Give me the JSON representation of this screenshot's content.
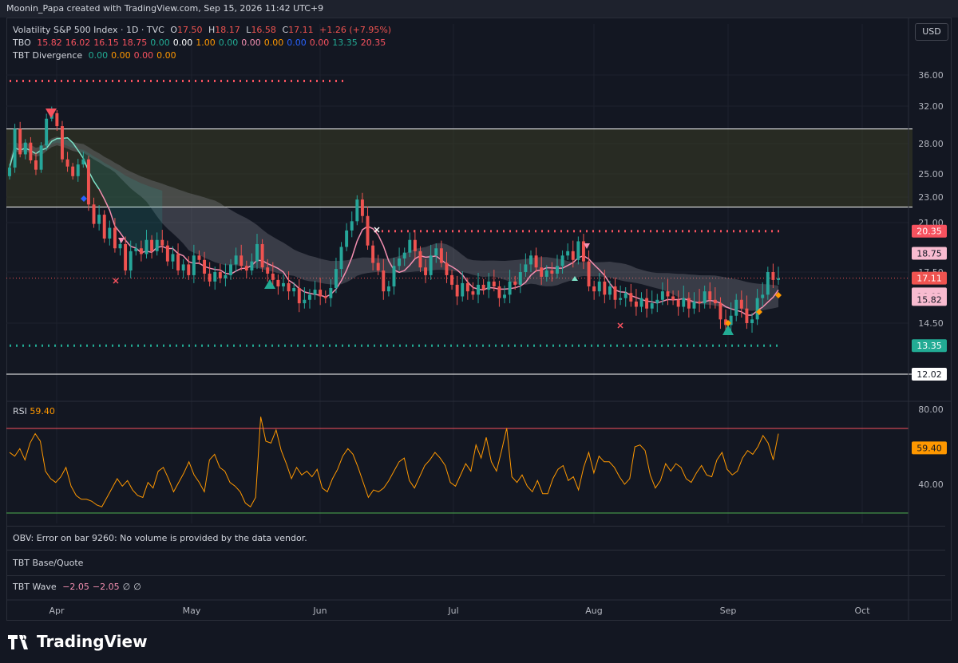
{
  "header": {
    "credit": "Moonin_Papa created with TradingView.com, Sep 15, 2026 11:42 UTC+9"
  },
  "legend": {
    "symbol": "Volatility S&P 500 Index · 1D · TVC",
    "ohlc": {
      "o_label": "O",
      "o": "17.50",
      "h_label": "H",
      "h": "18.17",
      "l_label": "L",
      "l": "16.58",
      "c_label": "C",
      "c": "17.11",
      "change": "+1.26 (+7.95%)"
    },
    "tbo_label": "TBO",
    "tbo_values": [
      {
        "v": "15.82",
        "color": "#f7525f"
      },
      {
        "v": "16.02",
        "color": "#f7525f"
      },
      {
        "v": "16.15",
        "color": "#f7525f"
      },
      {
        "v": "18.75",
        "color": "#f7525f"
      },
      {
        "v": "0.00",
        "color": "#22ab94"
      },
      {
        "v": "0.00",
        "color": "#ffffff"
      },
      {
        "v": "1.00",
        "color": "#ff9800"
      },
      {
        "v": "0.00",
        "color": "#22ab94"
      },
      {
        "v": "0.00",
        "color": "#f48fb1"
      },
      {
        "v": "0.00",
        "color": "#ff9800"
      },
      {
        "v": "0.00",
        "color": "#2962ff"
      },
      {
        "v": "0.00",
        "color": "#f7525f"
      },
      {
        "v": "13.35",
        "color": "#22ab94"
      },
      {
        "v": "20.35",
        "color": "#f7525f"
      }
    ],
    "div_label": "TBT Divergence",
    "div_values": [
      {
        "v": "0.00",
        "color": "#22ab94"
      },
      {
        "v": "0.00",
        "color": "#ff9800"
      },
      {
        "v": "0.00",
        "color": "#f7525f"
      },
      {
        "v": "0.00",
        "color": "#ff9800"
      }
    ]
  },
  "currency_button": "USD",
  "colors": {
    "up": "#26a69a",
    "down": "#ef5350",
    "bg": "#131722",
    "grid": "#1e222d",
    "rsi": "#ff9800",
    "pink": "#f48fb1"
  },
  "chart_data": {
    "type": "candlestick",
    "x_labels": [
      "Apr",
      "May",
      "Jun",
      "Jul",
      "Aug",
      "Sep",
      "Oct"
    ],
    "price_ticks": [
      "36.00",
      "32.00",
      "28.00",
      "25.00",
      "23.00",
      "21.00",
      "17.50",
      "14.50"
    ],
    "price_tags": [
      {
        "label": "20.35",
        "value": 20.35,
        "bg": "#f7525f",
        "fg": "#ffffff"
      },
      {
        "label": "18.75",
        "value": 18.75,
        "bg": "#f8bbd0",
        "fg": "#131722"
      },
      {
        "label": "17.11",
        "value": 17.11,
        "bg": "#ef5350",
        "fg": "#ffffff"
      },
      {
        "label": "16.15",
        "value": 16.15,
        "bg": "#f8bbd0",
        "fg": "#131722"
      },
      {
        "label": "16.02",
        "value": 16.02,
        "bg": "#f8bbd0",
        "fg": "#131722"
      },
      {
        "label": "15.82",
        "value": 15.82,
        "bg": "#f8bbd0",
        "fg": "#131722"
      },
      {
        "label": "13.35",
        "value": 13.35,
        "bg": "#22ab94",
        "fg": "#ffffff"
      },
      {
        "label": "12.02",
        "value": 12.02,
        "bg": "#ffffff",
        "fg": "#131722"
      }
    ],
    "levels": {
      "upper_box": 29.5,
      "mid_line": 22.2,
      "lower_line": 12.02,
      "red_dot_high": 35.2,
      "red_dot_mid": 20.35,
      "green_dot": 13.35
    },
    "closes": [
      25.6,
      29.5,
      26.9,
      28.1,
      26.3,
      25.4,
      27.8,
      30.6,
      31.2,
      29.8,
      26.4,
      25.7,
      24.8,
      25.9,
      26.4,
      22.4,
      20.9,
      21.6,
      19.8,
      20.6,
      19.1,
      19.4,
      17.6,
      18.9,
      19.1,
      18.7,
      19.7,
      18.9,
      19.7,
      19.3,
      18.2,
      18.7,
      17.6,
      18.0,
      17.3,
      18.6,
      18.3,
      17.4,
      16.9,
      17.5,
      17.1,
      17.3,
      18.0,
      18.6,
      17.9,
      17.6,
      18.2,
      19.4,
      17.8,
      17.4,
      17.0,
      16.6,
      16.8,
      16.3,
      16.5,
      15.6,
      15.8,
      16.1,
      16.4,
      16.0,
      15.9,
      16.5,
      17.7,
      19.2,
      20.4,
      21.1,
      22.8,
      21.5,
      19.3,
      18.1,
      17.6,
      16.3,
      16.6,
      17.9,
      18.4,
      18.8,
      19.7,
      18.9,
      17.8,
      17.3,
      18.6,
      19.1,
      18.1,
      17.3,
      16.7,
      16.0,
      16.8,
      16.3,
      16.1,
      16.7,
      16.4,
      16.9,
      16.6,
      15.9,
      16.1,
      16.9,
      16.7,
      17.5,
      18.0,
      18.6,
      17.8,
      17.2,
      17.6,
      17.4,
      17.9,
      18.6,
      18.9,
      18.3,
      19.6,
      18.2,
      16.6,
      16.3,
      16.9,
      16.1,
      16.6,
      15.8,
      15.9,
      16.2,
      15.7,
      15.4,
      15.9,
      15.3,
      15.6,
      15.8,
      16.3,
      16.0,
      15.8,
      15.4,
      15.9,
      15.3,
      15.7,
      15.6,
      16.3,
      15.8,
      15.6,
      14.7,
      14.4,
      14.9,
      15.8,
      15.3,
      14.5,
      14.7,
      15.9,
      16.1,
      17.5,
      17.0,
      17.1
    ],
    "rsi_label": "RSI",
    "rsi_value_label": "59.40",
    "rsi_ticks": [
      "80.00",
      "40.00"
    ],
    "rsi": [
      57,
      55,
      59,
      53,
      62,
      67,
      63,
      47,
      43,
      41,
      44,
      49,
      39,
      34,
      32,
      32,
      31,
      29,
      28,
      33,
      38,
      43,
      39,
      42,
      37,
      34,
      33,
      41,
      38,
      47,
      49,
      43,
      36,
      41,
      46,
      52,
      45,
      41,
      36,
      53,
      56,
      49,
      47,
      41,
      39,
      36,
      30,
      28,
      33,
      76,
      63,
      62,
      69,
      58,
      51,
      43,
      49,
      45,
      47,
      44,
      48,
      38,
      36,
      43,
      48,
      55,
      59,
      56,
      49,
      41,
      33,
      37,
      36,
      38,
      42,
      47,
      52,
      54,
      42,
      38,
      44,
      50,
      53,
      57,
      54,
      50,
      41,
      39,
      45,
      51,
      47,
      61,
      54,
      65,
      52,
      47,
      58,
      70,
      44,
      41,
      45,
      39,
      36,
      42,
      35,
      35,
      43,
      48,
      50,
      42,
      44,
      37,
      49,
      57,
      46,
      55,
      52,
      52,
      49,
      44,
      40,
      43,
      60,
      61,
      58,
      45,
      38,
      42,
      51,
      47,
      51,
      49,
      43,
      41,
      46,
      50,
      45,
      44,
      53,
      57,
      48,
      45,
      47,
      54,
      58,
      56,
      60,
      66,
      62,
      53,
      67
    ],
    "obv_text": "OBV: Error on bar 9260: No volume is provided by the data vendor.",
    "base_quote_label": "TBT Base/Quote",
    "wave_label": "TBT Wave",
    "wave_values": [
      "−2.05",
      "−2.05",
      "∅",
      "∅"
    ]
  },
  "brand": {
    "name": "TradingView"
  }
}
